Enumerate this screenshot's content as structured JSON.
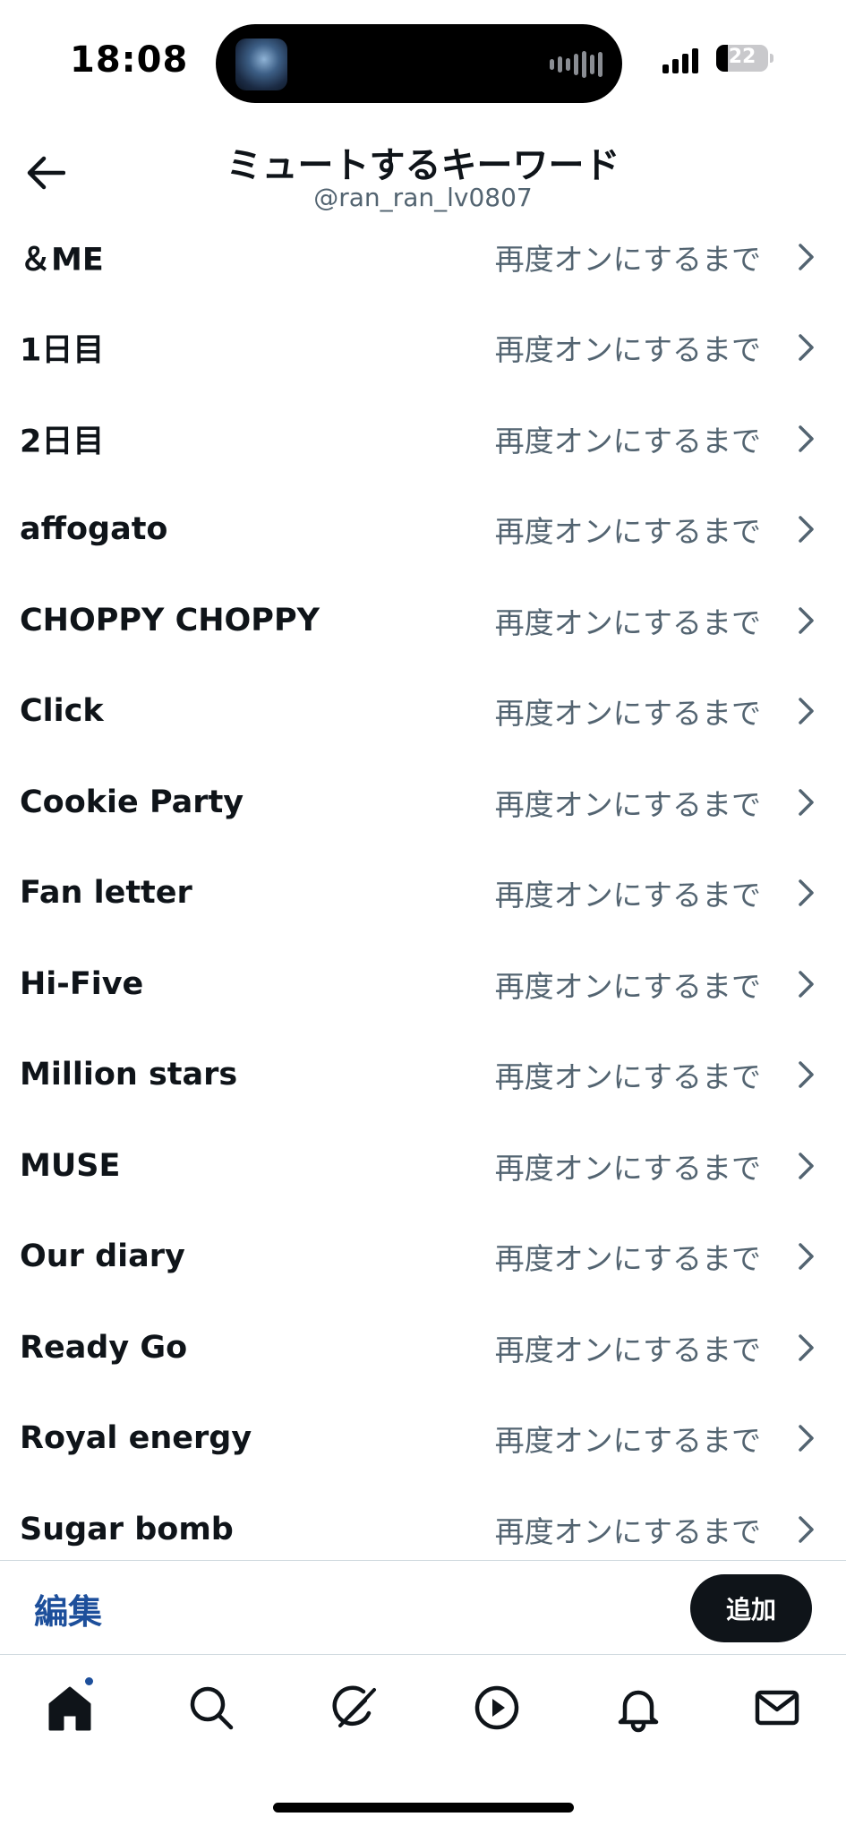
{
  "status_bar": {
    "time": "18:08",
    "battery_level": "22",
    "battery_fraction": 0.22
  },
  "header": {
    "title": "ミュートするキーワード",
    "handle": "@ran_ran_lv0807"
  },
  "keywords": [
    {
      "keyword": "＆ME",
      "duration": "再度オンにするまで"
    },
    {
      "keyword": "1日目",
      "duration": "再度オンにするまで"
    },
    {
      "keyword": "2日目",
      "duration": "再度オンにするまで"
    },
    {
      "keyword": "affogato",
      "duration": "再度オンにするまで"
    },
    {
      "keyword": "CHOPPY CHOPPY",
      "duration": "再度オンにするまで"
    },
    {
      "keyword": "Click",
      "duration": "再度オンにするまで"
    },
    {
      "keyword": "Cookie Party",
      "duration": "再度オンにするまで"
    },
    {
      "keyword": "Fan letter",
      "duration": "再度オンにするまで"
    },
    {
      "keyword": "Hi-Five",
      "duration": "再度オンにするまで"
    },
    {
      "keyword": "Million stars",
      "duration": "再度オンにするまで"
    },
    {
      "keyword": "MUSE",
      "duration": "再度オンにするまで"
    },
    {
      "keyword": "Our diary",
      "duration": "再度オンにするまで"
    },
    {
      "keyword": "Ready Go",
      "duration": "再度オンにするまで"
    },
    {
      "keyword": "Royal energy",
      "duration": "再度オンにするまで"
    },
    {
      "keyword": "Sugar bomb",
      "duration": "再度オンにするまで"
    }
  ],
  "bottom_bar": {
    "edit_label": "編集",
    "add_label": "追加"
  },
  "tabs": [
    {
      "name": "home-icon"
    },
    {
      "name": "search-icon"
    },
    {
      "name": "grok-icon"
    },
    {
      "name": "play-icon"
    },
    {
      "name": "bell-icon"
    },
    {
      "name": "mail-icon"
    }
  ],
  "colors": {
    "text_primary": "#0f1419",
    "text_secondary": "#536471",
    "accent": "#1d4f9b",
    "add_button": "#0f1419"
  }
}
